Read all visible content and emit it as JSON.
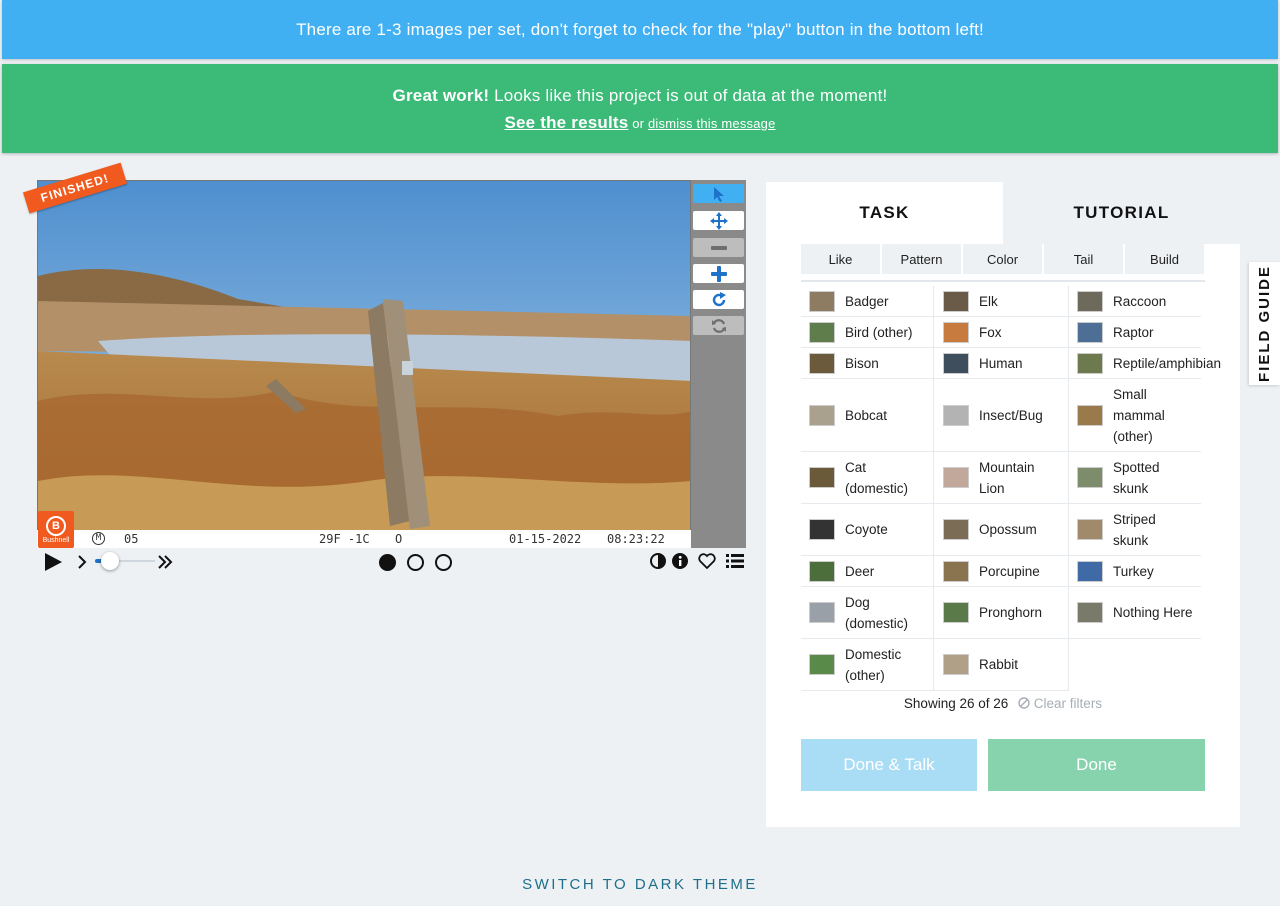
{
  "banner_info": "There are 1-3 images per set, don't forget to check for the \"play\" button in the bottom left!",
  "banner_success": {
    "bold": "Great work!",
    "text": " Looks like this project is out of data at the moment!",
    "results_link": "See the results",
    "or": " or ",
    "dismiss_link": "dismiss this message"
  },
  "viewer": {
    "finished_label": "FINISHED!",
    "camera_brand": "Bushnell",
    "camera_brand_letter": "B",
    "strip": {
      "mode": "M",
      "frame": "05",
      "temp": "29F  -1C",
      "moon": "O",
      "date": "01-15-2022",
      "time": "08:23:22"
    },
    "frames": 3,
    "current_frame": 1,
    "playback_progress": 0.25
  },
  "toolbar": {
    "icons": [
      "pointer-icon",
      "move-icon",
      "zoom-out-icon",
      "zoom-in-icon",
      "rotate-icon",
      "reset-icon"
    ]
  },
  "task_panel": {
    "tabs": [
      "TASK",
      "TUTORIAL"
    ],
    "active_tab": "TASK",
    "filters": [
      "Like",
      "Pattern",
      "Color",
      "Tail",
      "Build"
    ],
    "species": [
      [
        "Badger",
        "Elk",
        "Raccoon"
      ],
      [
        "Bird (other)",
        "Fox",
        "Raptor"
      ],
      [
        "Bison",
        "Human",
        "Reptile/amphibian"
      ],
      [
        "Bobcat",
        "Insect/Bug",
        "Small mammal (other)"
      ],
      [
        "Cat (domestic)",
        "Mountain Lion",
        "Spotted skunk"
      ],
      [
        "Coyote",
        "Opossum",
        "Striped skunk"
      ],
      [
        "Deer",
        "Porcupine",
        "Turkey"
      ],
      [
        "Dog (domestic)",
        "Pronghorn",
        "Nothing Here"
      ],
      [
        "Domestic (other)",
        "Rabbit",
        ""
      ]
    ],
    "showing": "Showing 26 of 26",
    "clear_filters": "Clear filters",
    "done_talk": "Done & Talk",
    "done": "Done"
  },
  "field_guide": "FIELD GUIDE",
  "theme_toggle": "SWITCH TO DARK THEME",
  "colors": {
    "info_banner": "#41b0f2",
    "success_banner": "#3cba78",
    "accent": "#1e72c9",
    "finished_tag": "#f05a1e"
  }
}
